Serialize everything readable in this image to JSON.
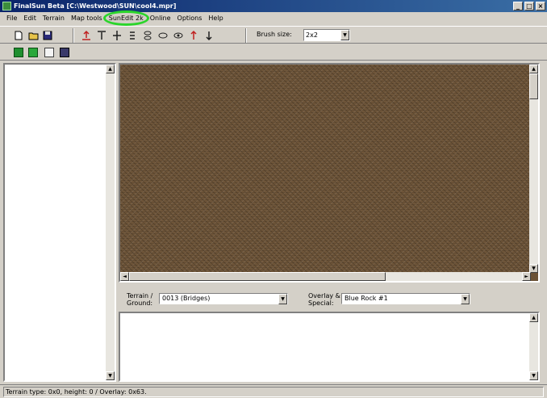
{
  "window": {
    "title": "FinalSun Beta [C:\\Westwood\\SUN\\cool4.mpr]",
    "controls": [
      "_",
      "□",
      "×"
    ]
  },
  "menu": {
    "items": [
      "File",
      "Edit",
      "Terrain",
      "Map tools",
      "SunEdit 2k",
      "Online",
      "Options",
      "Help"
    ],
    "highlighted_item": "SunEdit 2k",
    "highlight_color": "#2bd52b"
  },
  "toolbar": {
    "file_icons": [
      "new-file-icon",
      "open-folder-icon",
      "save-disk-icon"
    ],
    "height_tools": [
      "raise-ground-icon",
      "lower-ground-icon",
      "flatten-icon",
      "raise-tile-icon",
      "lower-tile-icon",
      "hide-icon",
      "show-icon",
      "raise-single-icon",
      "lower-single-icon"
    ],
    "brush_size_label": "Brush size:",
    "brush_size_value": "2x2"
  },
  "toolbar2": {
    "icons": [
      "green-flag-icon",
      "green-map-icon",
      "document-icon",
      "grid-icon"
    ]
  },
  "terrain": {
    "ground_label": "Terrain / Ground:",
    "ground_value": "0013 (Bridges)",
    "overlay_label": "Overlay & Special:",
    "overlay_value": "Blue Rock #1"
  },
  "status": {
    "text": "Terrain type: 0x0, height: 0 / Overlay: 0x63."
  }
}
